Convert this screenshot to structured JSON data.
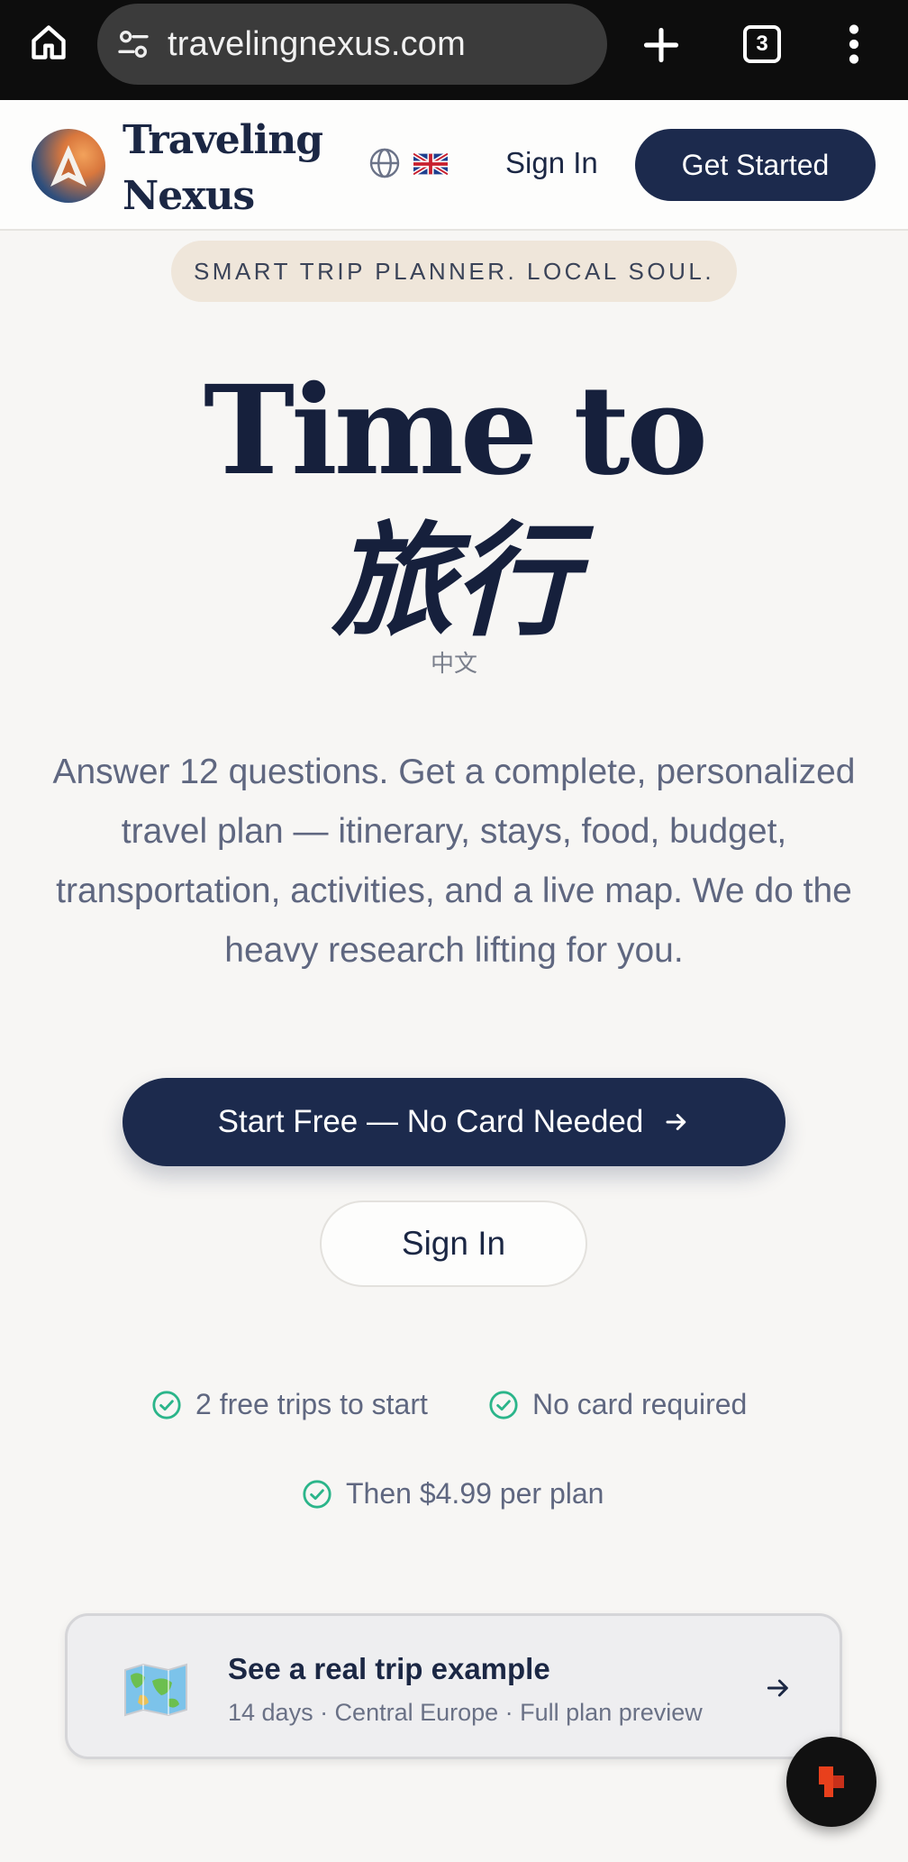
{
  "browser": {
    "url": "travelingnexus.com",
    "tab_count": "3"
  },
  "header": {
    "brand_line1": "Traveling",
    "brand_line2": "Nexus",
    "sign_in": "Sign In",
    "get_started": "Get Started"
  },
  "hero": {
    "tagline": "SMART TRIP PLANNER. LOCAL SOUL.",
    "title": "Time to",
    "title_cjk": "旅行",
    "cjk_caption": "中文",
    "description": "Answer 12 questions. Get a complete, personalized travel plan — itinerary, stays, food, budget, transportation, activities, and a live map. We do the heavy research lifting for you.",
    "primary_cta": "Start Free — No Card Needed",
    "secondary_cta": "Sign In"
  },
  "perks": [
    {
      "label": "2 free trips to start"
    },
    {
      "label": "No card required"
    },
    {
      "label": "Then $4.99 per plan"
    }
  ],
  "example": {
    "title": "See a real trip example",
    "subtitle": "14 days · Central Europe · Full plan preview"
  },
  "colors": {
    "navy": "#1c2a4d",
    "check_green": "#2bb58a",
    "pill_bg": "#efe6da",
    "fab_accent": "#e8401c"
  }
}
